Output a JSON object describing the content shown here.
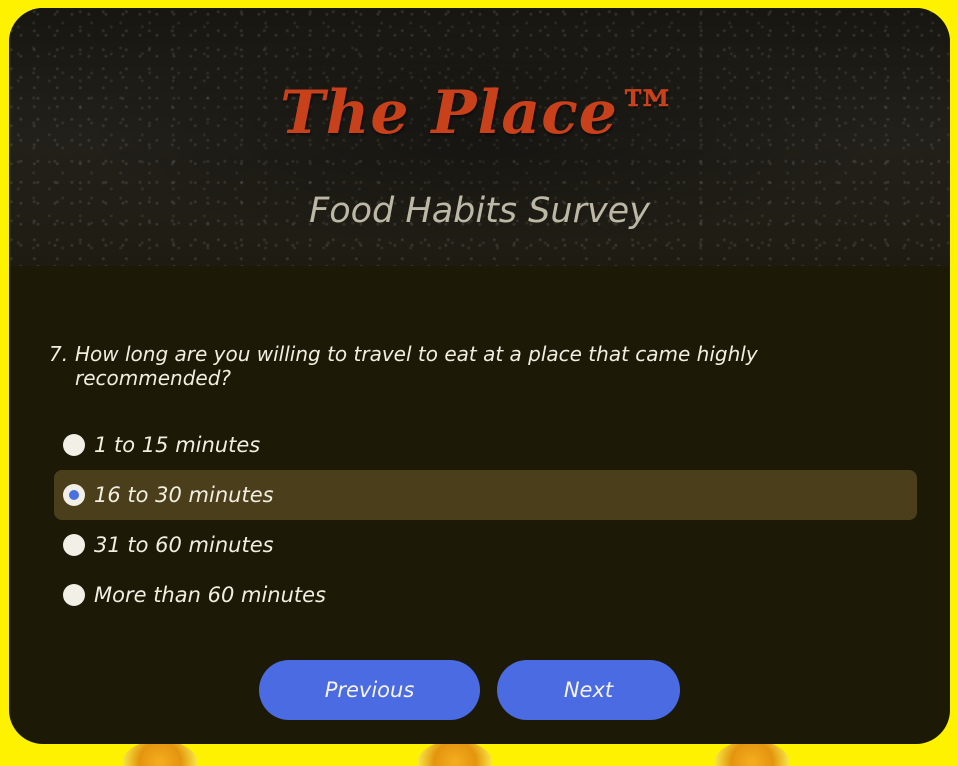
{
  "header": {
    "brand": "The Place™",
    "subtitle": "Food Habits Survey"
  },
  "question": {
    "number": "7.",
    "text": "How long are you willing to travel to eat at a place that came highly recommended?"
  },
  "options": [
    {
      "label": "1 to 15 minutes",
      "checked": false
    },
    {
      "label": "16 to 30 minutes",
      "checked": true
    },
    {
      "label": "31 to 60 minutes",
      "checked": false
    },
    {
      "label": "More than 60 minutes",
      "checked": false
    }
  ],
  "nav": {
    "previous_label": "Previous",
    "next_label": "Next"
  },
  "colors": {
    "page_background": "#fff200",
    "card_background": "#1c1907",
    "brand": "#c8411b",
    "accent": "#4a6be2",
    "selected_row": "#4b3f1b"
  }
}
